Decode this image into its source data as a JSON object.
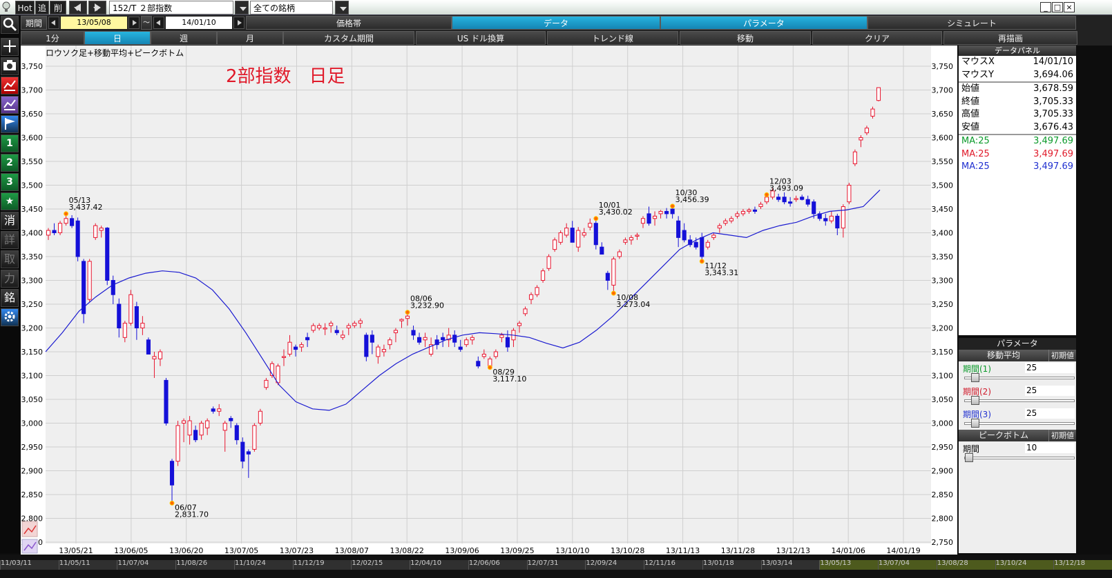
{
  "window": {
    "hot_label": "Hot",
    "add_label": "追",
    "delete_label": "削",
    "symbol_value": "152/T ２部指数",
    "list_value": "全ての銘柄",
    "win_buttons": [
      "_",
      "□",
      "×"
    ]
  },
  "toolbar": {
    "period_label": "期間",
    "start_date": "13/05/08",
    "tilde": "～",
    "end_date": "14/01/10",
    "right_tabs": [
      {
        "label": "価格帯",
        "active": false
      },
      {
        "label": "データ",
        "active": true
      },
      {
        "label": "パラメータ",
        "active": true
      },
      {
        "label": "シミュレート",
        "active": false
      }
    ],
    "interval_tabs": [
      {
        "label": "1分",
        "active": false
      },
      {
        "label": "日",
        "active": true
      },
      {
        "label": "週",
        "active": false
      },
      {
        "label": "月",
        "active": false
      },
      {
        "label": "カスタム期間",
        "active": false
      },
      {
        "label": "US ドル換算",
        "active": false
      },
      {
        "label": "トレンド線",
        "active": false
      },
      {
        "label": "移動",
        "active": false
      },
      {
        "label": "クリア",
        "active": false
      },
      {
        "label": "再描画",
        "active": false
      }
    ]
  },
  "sidebar": {
    "icons": [
      "search-icon",
      "crosshair-icon",
      "camera-icon",
      "chart-red-icon",
      "chart-purple-icon",
      "flag-icon",
      "preset-1",
      "preset-2",
      "preset-3",
      "star-icon",
      "erase",
      "detail",
      "trade",
      "power",
      "stock",
      "gear-icon"
    ],
    "labels": [
      "1",
      "2",
      "3",
      "消",
      "詳",
      "取",
      "力",
      "銘"
    ]
  },
  "chart": {
    "subtitle": "ロウソク足+移動平均+ピークボトム",
    "title": "2部指数　日足",
    "y_ticks": [
      "3,750",
      "3,700",
      "3,650",
      "3,600",
      "3,550",
      "3,500",
      "3,450",
      "3,400",
      "3,350",
      "3,300",
      "3,250",
      "3,200",
      "3,150",
      "3,100",
      "3,050",
      "3,000",
      "2,950",
      "2,900",
      "2,850",
      "2,800",
      "2,750"
    ],
    "x_ticks": [
      "13/05/21",
      "13/06/05",
      "13/06/20",
      "13/07/05",
      "13/07/23",
      "13/08/07",
      "13/08/22",
      "13/09/06",
      "13/09/25",
      "13/10/10",
      "13/10/28",
      "13/11/13",
      "13/11/28",
      "13/12/13",
      "14/01/06",
      "14/01/19"
    ],
    "annotations": [
      {
        "date": "05/13",
        "value": "3,437.42"
      },
      {
        "date": "06/07",
        "value": "2,831.70"
      },
      {
        "date": "08/06",
        "value": "3,232.90"
      },
      {
        "date": "08/29",
        "value": "3,117.10"
      },
      {
        "date": "10/01",
        "value": "3,430.02"
      },
      {
        "date": "10/08",
        "value": "3,273.04"
      },
      {
        "date": "10/30",
        "value": "3,456.39"
      },
      {
        "date": "11/12",
        "value": "3,343.31"
      },
      {
        "date": "12/03",
        "value": "3,493.09"
      }
    ]
  },
  "chart_data": {
    "type": "candlestick",
    "ylim": [
      2750,
      3760
    ],
    "up_color": "#e8142d",
    "down_color": "#1510d8",
    "ma_color": "#1a1ad0",
    "ma_period": 25,
    "candles": [
      [
        3395,
        3410,
        3385,
        3405
      ],
      [
        3405,
        3420,
        3395,
        3400
      ],
      [
        3400,
        3425,
        3395,
        3420
      ],
      [
        3420,
        3440,
        3415,
        3430
      ],
      [
        3430,
        3437,
        3410,
        3415
      ],
      [
        3425,
        3432,
        3340,
        3350
      ],
      [
        3340,
        3345,
        3210,
        3230
      ],
      [
        3260,
        3345,
        3255,
        3340
      ],
      [
        3390,
        3420,
        3385,
        3415
      ],
      [
        3405,
        3415,
        3390,
        3410
      ],
      [
        3410,
        3412,
        3290,
        3300
      ],
      [
        3300,
        3310,
        3250,
        3270
      ],
      [
        3250,
        3262,
        3180,
        3200
      ],
      [
        3180,
        3215,
        3170,
        3210
      ],
      [
        3210,
        3280,
        3205,
        3270
      ],
      [
        3245,
        3255,
        3175,
        3200
      ],
      [
        3200,
        3225,
        3185,
        3210
      ],
      [
        3175,
        3180,
        3145,
        3145
      ],
      [
        3135,
        3150,
        3095,
        3140
      ],
      [
        3135,
        3155,
        3120,
        3150
      ],
      [
        3090,
        3095,
        2995,
        3000
      ],
      [
        2920,
        2925,
        2832,
        2870
      ],
      [
        2920,
        3005,
        2910,
        2995
      ],
      [
        3000,
        3010,
        2960,
        3005
      ],
      [
        2975,
        3015,
        2955,
        3005
      ],
      [
        2985,
        2995,
        2960,
        2965
      ],
      [
        2975,
        3005,
        2965,
        3000
      ],
      [
        2990,
        3010,
        2975,
        3005
      ],
      [
        3030,
        3035,
        3020,
        3025
      ],
      [
        3025,
        3040,
        3015,
        3030
      ],
      [
        2985,
        3005,
        2940,
        3000
      ],
      [
        3010,
        3015,
        2990,
        3005
      ],
      [
        2995,
        3000,
        2955,
        2965
      ],
      [
        2960,
        2970,
        2905,
        2920
      ],
      [
        2940,
        2945,
        2885,
        2935
      ],
      [
        2945,
        3000,
        2940,
        2995
      ],
      [
        3000,
        3030,
        2995,
        3025
      ],
      [
        3075,
        3095,
        3070,
        3090
      ],
      [
        3100,
        3130,
        3095,
        3125
      ],
      [
        3085,
        3125,
        3080,
        3120
      ],
      [
        3140,
        3155,
        3120,
        3140
      ],
      [
        3145,
        3185,
        3140,
        3170
      ],
      [
        3160,
        3165,
        3140,
        3155
      ],
      [
        3160,
        3170,
        3150,
        3165
      ],
      [
        3180,
        3190,
        3160,
        3175
      ],
      [
        3195,
        3210,
        3190,
        3205
      ],
      [
        3200,
        3210,
        3195,
        3205
      ],
      [
        3200,
        3210,
        3185,
        3200
      ],
      [
        3205,
        3215,
        3190,
        3210
      ],
      [
        3195,
        3205,
        3185,
        3190
      ],
      [
        3180,
        3195,
        3175,
        3185
      ],
      [
        3200,
        3210,
        3185,
        3205
      ],
      [
        3205,
        3215,
        3200,
        3210
      ],
      [
        3210,
        3220,
        3200,
        3215
      ],
      [
        3185,
        3190,
        3130,
        3140
      ],
      [
        3185,
        3195,
        3145,
        3170
      ],
      [
        3140,
        3165,
        3125,
        3160
      ],
      [
        3150,
        3165,
        3140,
        3155
      ],
      [
        3165,
        3180,
        3155,
        3175
      ],
      [
        3190,
        3200,
        3170,
        3195
      ],
      [
        3215,
        3220,
        3200,
        3218
      ],
      [
        3220,
        3233,
        3205,
        3225
      ],
      [
        3195,
        3205,
        3175,
        3185
      ],
      [
        3180,
        3190,
        3165,
        3170
      ],
      [
        3175,
        3190,
        3160,
        3180
      ],
      [
        3145,
        3180,
        3140,
        3165
      ],
      [
        3175,
        3185,
        3155,
        3165
      ],
      [
        3180,
        3190,
        3160,
        3175
      ],
      [
        3175,
        3200,
        3160,
        3185
      ],
      [
        3185,
        3195,
        3160,
        3170
      ],
      [
        3160,
        3175,
        3150,
        3155
      ],
      [
        3165,
        3180,
        3160,
        3175
      ],
      [
        3175,
        3185,
        3165,
        3180
      ],
      [
        3130,
        3140,
        3115,
        3120
      ],
      [
        3140,
        3155,
        3135,
        3145
      ],
      [
        3120,
        3140,
        3117,
        3135
      ],
      [
        3140,
        3155,
        3135,
        3150
      ],
      [
        3180,
        3190,
        3170,
        3185
      ],
      [
        3180,
        3195,
        3150,
        3160
      ],
      [
        3175,
        3200,
        3160,
        3195
      ],
      [
        3205,
        3215,
        3190,
        3210
      ],
      [
        3230,
        3245,
        3225,
        3240
      ],
      [
        3260,
        3275,
        3250,
        3270
      ],
      [
        3270,
        3290,
        3265,
        3285
      ],
      [
        3300,
        3325,
        3295,
        3320
      ],
      [
        3325,
        3355,
        3320,
        3350
      ],
      [
        3365,
        3390,
        3360,
        3385
      ],
      [
        3380,
        3405,
        3375,
        3400
      ],
      [
        3395,
        3420,
        3390,
        3410
      ],
      [
        3410,
        3425,
        3390,
        3380
      ],
      [
        3370,
        3412,
        3360,
        3405
      ],
      [
        3395,
        3410,
        3390,
        3400
      ],
      [
        3412,
        3430,
        3405,
        3420
      ],
      [
        3420,
        3430,
        3365,
        3375
      ],
      [
        3370,
        3380,
        3355,
        3355
      ],
      [
        3315,
        3320,
        3280,
        3300
      ],
      [
        3290,
        3350,
        3273,
        3345
      ],
      [
        3350,
        3365,
        3345,
        3360
      ],
      [
        3380,
        3390,
        3375,
        3385
      ],
      [
        3385,
        3395,
        3375,
        3390
      ],
      [
        3395,
        3400,
        3385,
        3395
      ],
      [
        3420,
        3435,
        3410,
        3430
      ],
      [
        3440,
        3455,
        3415,
        3420
      ],
      [
        3430,
        3445,
        3415,
        3435
      ],
      [
        3440,
        3448,
        3430,
        3445
      ],
      [
        3445,
        3452,
        3430,
        3440
      ],
      [
        3450,
        3456,
        3430,
        3440
      ],
      [
        3425,
        3435,
        3370,
        3390
      ],
      [
        3405,
        3420,
        3380,
        3385
      ],
      [
        3385,
        3395,
        3370,
        3375
      ],
      [
        3380,
        3390,
        3365,
        3370
      ],
      [
        3390,
        3400,
        3340,
        3350
      ],
      [
        3370,
        3385,
        3365,
        3380
      ],
      [
        3390,
        3400,
        3385,
        3395
      ],
      [
        3410,
        3420,
        3400,
        3415
      ],
      [
        3420,
        3430,
        3415,
        3425
      ],
      [
        3425,
        3435,
        3420,
        3430
      ],
      [
        3435,
        3445,
        3430,
        3440
      ],
      [
        3440,
        3450,
        3435,
        3445
      ],
      [
        3445,
        3452,
        3440,
        3448
      ],
      [
        3448,
        3455,
        3440,
        3445
      ],
      [
        3455,
        3465,
        3450,
        3460
      ],
      [
        3465,
        3480,
        3460,
        3475
      ],
      [
        3475,
        3493,
        3470,
        3488
      ],
      [
        3475,
        3482,
        3465,
        3470
      ],
      [
        3475,
        3485,
        3460,
        3465
      ],
      [
        3465,
        3475,
        3455,
        3462
      ],
      [
        3470,
        3478,
        3465,
        3472
      ],
      [
        3475,
        3480,
        3468,
        3470
      ],
      [
        3470,
        3478,
        3455,
        3460
      ],
      [
        3465,
        3470,
        3430,
        3440
      ],
      [
        3440,
        3445,
        3425,
        3430
      ],
      [
        3430,
        3440,
        3415,
        3425
      ],
      [
        3425,
        3445,
        3420,
        3435
      ],
      [
        3435,
        3440,
        3395,
        3410
      ],
      [
        3410,
        3460,
        3390,
        3455
      ],
      [
        3465,
        3505,
        3460,
        3500
      ],
      [
        3545,
        3575,
        3540,
        3570
      ],
      [
        3595,
        3605,
        3580,
        3600
      ],
      [
        3610,
        3625,
        3605,
        3620
      ],
      [
        3645,
        3665,
        3640,
        3660
      ],
      [
        3678,
        3705,
        3676,
        3705
      ]
    ],
    "ma": [
      3150,
      3190,
      3235,
      3265,
      3290,
      3305,
      3315,
      3320,
      3317,
      3305,
      3280,
      3240,
      3190,
      3135,
      3080,
      3045,
      3030,
      3027,
      3040,
      3070,
      3100,
      3125,
      3145,
      3160,
      3175,
      3185,
      3190,
      3188,
      3185,
      3180,
      3168,
      3158,
      3170,
      3195,
      3225,
      3260,
      3295,
      3330,
      3365,
      3385,
      3400,
      3395,
      3390,
      3405,
      3415,
      3422,
      3435,
      3445,
      3448,
      3455,
      3490
    ]
  },
  "data_panel": {
    "title": "データパネル",
    "mouse": [
      {
        "k": "マウスX",
        "v": "14/01/10"
      },
      {
        "k": "マウスY",
        "v": "3,694.06"
      }
    ],
    "ohlc": [
      {
        "k": "始値",
        "v": "3,678.59"
      },
      {
        "k": "終値",
        "v": "3,705.33"
      },
      {
        "k": "高値",
        "v": "3,705.33"
      },
      {
        "k": "安値",
        "v": "3,676.43"
      }
    ],
    "ma": [
      {
        "k": "MA:25",
        "v": "3,497.69",
        "color": "#0a9a2a"
      },
      {
        "k": "MA:25",
        "v": "3,497.69",
        "color": "#e01a2a"
      },
      {
        "k": "MA:25",
        "v": "3,497.69",
        "color": "#2030d0"
      }
    ]
  },
  "param_panel": {
    "title": "パラメータ",
    "ma_title": "移動平均",
    "reset_label": "初期値",
    "ma_rows": [
      {
        "label": "期間(1)",
        "value": "25",
        "color": "#0a9a2a",
        "level": 0.1
      },
      {
        "label": "期間(2)",
        "value": "25",
        "color": "#d01a2a",
        "level": 0.1
      },
      {
        "label": "期間(3)",
        "value": "25",
        "color": "#2030d0",
        "level": 0.1
      }
    ],
    "pb_title": "ピークボトム",
    "pb_rows": [
      {
        "label": "期間",
        "value": "10",
        "color": "#000000",
        "level": 0.02
      }
    ]
  },
  "bottom_strip": [
    "11/03/11",
    "11/05/11",
    "11/07/04",
    "11/08/26",
    "11/10/24",
    "11/12/19",
    "12/02/15",
    "12/04/10",
    "12/06/06",
    "12/07/31",
    "12/09/24",
    "12/11/16",
    "13/01/18",
    "13/03/14",
    "13/05/13",
    "13/07/04",
    "13/08/28",
    "13/10/24",
    "13/12/18"
  ]
}
